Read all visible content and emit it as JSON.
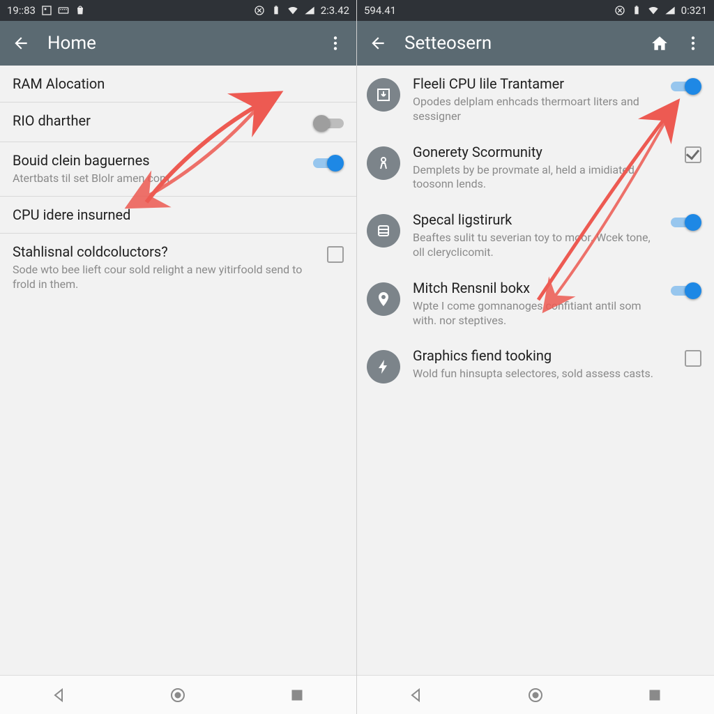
{
  "left": {
    "status": {
      "time_left": "19::83",
      "time_right": "2:3.42"
    },
    "appbar": {
      "title": "Home"
    },
    "rows": [
      {
        "title": "RAM Alocation",
        "sub": "",
        "ctrl": "none"
      },
      {
        "title": "RIO dharther",
        "sub": "",
        "ctrl": "switch",
        "on": false
      },
      {
        "title": "Bouid clein baguernes",
        "sub": "Atertbats til set Blolr amen com",
        "ctrl": "switch",
        "on": true
      },
      {
        "title": "CPU idere insurned",
        "sub": "",
        "ctrl": "none"
      },
      {
        "title": "Stahlisnal coldcoluctors?",
        "sub": "Sode wto bee lieft cour sold relight a new yitirfoold send to frold in them.",
        "ctrl": "checkbox",
        "on": false
      }
    ]
  },
  "right": {
    "status": {
      "time_left": "594.41",
      "time_right": "0:321"
    },
    "appbar": {
      "title": "Setteosern"
    },
    "rows": [
      {
        "icon": "download",
        "title": "Fleeli CPU lile Trantamer",
        "sub": "Opodes delplam enhcads thermoart liters and sessigner",
        "ctrl": "switch",
        "on": true
      },
      {
        "icon": "security",
        "title": "Gonerety Scormunity",
        "sub": "Demplets by be provmate al, held a imidiated toosonn lends.",
        "ctrl": "checkbox",
        "on": true
      },
      {
        "icon": "storage",
        "title": "Specal ligstirurk",
        "sub": "Beaftes sulit tu severian toy to moor. Wcek tone, oll cleryclicomit.",
        "ctrl": "switch",
        "on": true
      },
      {
        "icon": "location",
        "title": "Mitch Rensnil bokx",
        "sub": "Wpte I come gomnanoges confitiant antil som with. nor steptives.",
        "ctrl": "switch",
        "on": true
      },
      {
        "icon": "bolt",
        "title": "Graphics fiend tooking",
        "sub": "Wold fun hinsupta selectores, sold assess casts.",
        "ctrl": "checkbox",
        "on": false
      }
    ]
  },
  "colors": {
    "accent": "#1e88e5",
    "appbar": "#5b6a72",
    "status": "#2e3237",
    "annot": "#ed5a52"
  }
}
